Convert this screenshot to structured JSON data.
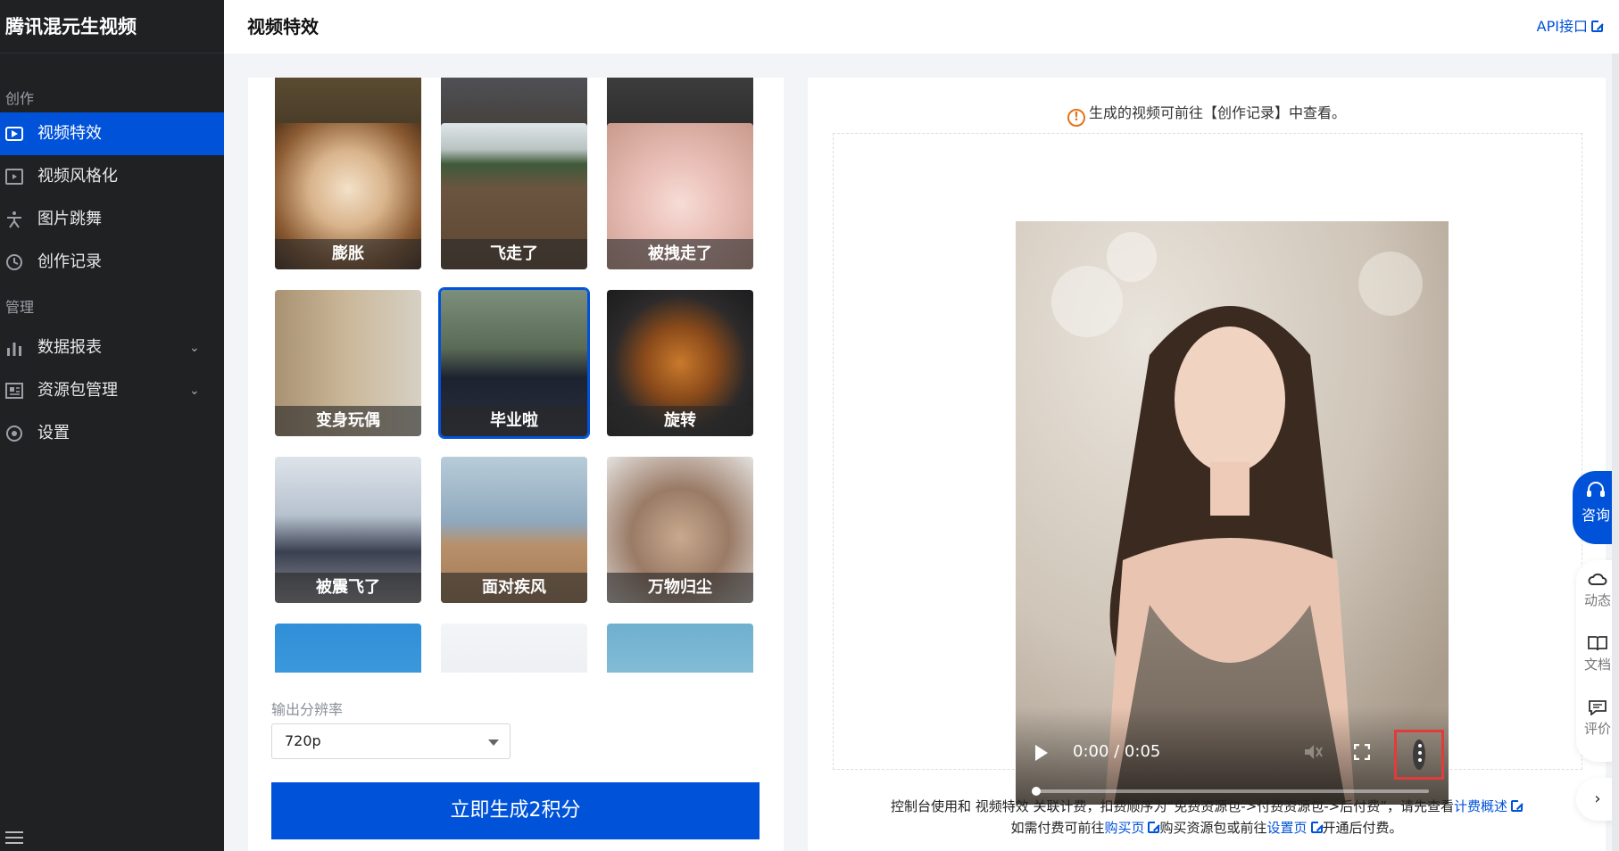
{
  "app": {
    "brand": "腾讯混元生视频"
  },
  "sidebar": {
    "group_create": "创作",
    "group_manage": "管理",
    "items": [
      {
        "label": "视频特效",
        "icon": "video-effect-icon",
        "active": true
      },
      {
        "label": "视频风格化",
        "icon": "video-play-icon"
      },
      {
        "label": "图片跳舞",
        "icon": "dance-icon"
      },
      {
        "label": "创作记录",
        "icon": "history-icon"
      },
      {
        "label": "数据报表",
        "icon": "bar-chart-icon",
        "expandable": true
      },
      {
        "label": "资源包管理",
        "icon": "package-icon",
        "expandable": true
      },
      {
        "label": "设置",
        "icon": "settings-icon"
      }
    ]
  },
  "header": {
    "title": "视频特效",
    "api_link": "API接口"
  },
  "effects": [
    {
      "label": "膨胀"
    },
    {
      "label": "飞走了"
    },
    {
      "label": "被拽走了"
    },
    {
      "label": "变身玩偶"
    },
    {
      "label": "毕业啦",
      "selected": true
    },
    {
      "label": "旋转"
    },
    {
      "label": "被震飞了"
    },
    {
      "label": "面对疾风"
    },
    {
      "label": "万物归尘"
    }
  ],
  "form": {
    "resolution_label": "输出分辨率",
    "resolution_value": "720p",
    "generate_button": "立即生成2积分"
  },
  "preview": {
    "notice": "生成的视频可前往【创作记录】中查看。",
    "time_display": "0:00 / 0:05",
    "progress": 0
  },
  "footer": {
    "line1_prefix": "控制台使用和 视频特效 关联计费，扣费顺序为“免费资源包->付费资源包->后付费”，请先查看",
    "line1_link": "计费概述",
    "line2_prefix": "如需付费可前往",
    "line2_link1": "购买页",
    "line2_mid": "购买资源包或前往",
    "line2_link2": "设置页",
    "line2_suffix": "开通后付费。"
  },
  "float_tools": {
    "consult": "咨询",
    "news": "动态",
    "docs": "文档",
    "review": "评价"
  },
  "colors": {
    "primary": "#0052d9",
    "sidebar_bg": "#1f2123",
    "warning": "#e37318",
    "highlight": "#e23b3b"
  }
}
